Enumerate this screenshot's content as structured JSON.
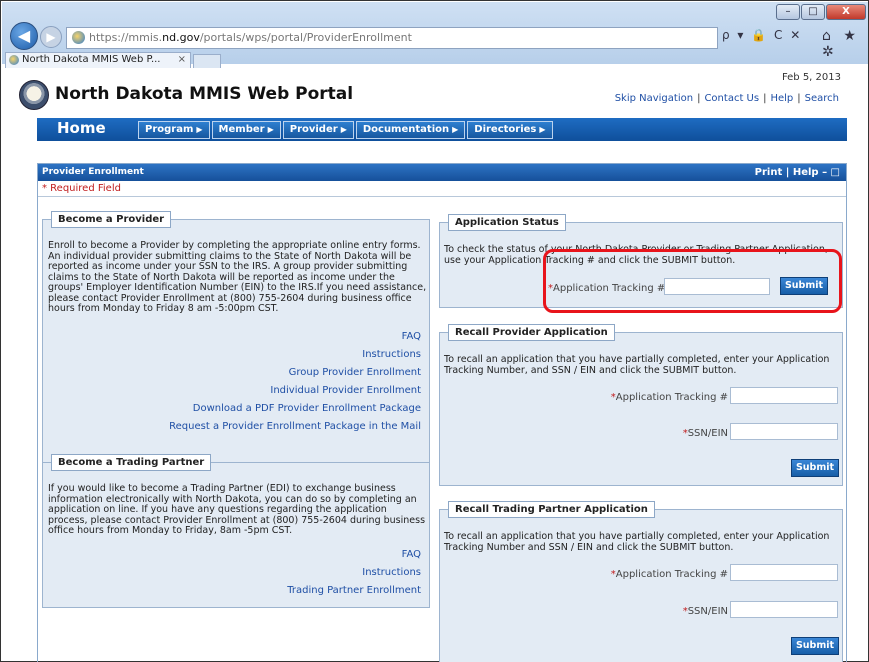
{
  "browser": {
    "url_prefix": "https://mmis.",
    "url_domain": "nd.gov",
    "url_path": "/portals/wps/portal/ProviderEnrollment",
    "tab_title": "North Dakota MMIS Web P...",
    "tab_close": "×",
    "addr_tools": "ρ ▾ 🔒 C ✕",
    "home_star": "⌂ ★ ✲",
    "win_min": "–",
    "win_max": "□",
    "win_close": "X",
    "back": "◀",
    "forward": "▶"
  },
  "header": {
    "date": "Feb 5, 2013",
    "title": "North Dakota MMIS Web Portal",
    "links": [
      "Skip Navigation",
      "Contact Us",
      "Help",
      "Search"
    ],
    "sep": "|"
  },
  "nav": {
    "home": "Home",
    "items": [
      "Program",
      "Member",
      "Provider",
      "Documentation",
      "Directories"
    ],
    "arrow": "▶"
  },
  "panel": {
    "title": "Provider Enrollment",
    "tools": "Print | Help  –  □",
    "required": "* Required Field"
  },
  "become_provider": {
    "title": "Become a Provider",
    "text": "Enroll to become a Provider by completing the appropriate online entry forms. An individual provider submitting claims to the State of North Dakota will be reported as income under your SSN to the IRS. A group provider submitting claims to the State of North Dakota will be reported as income under the groups' Employer Identification Number (EIN) to the IRS.If you need assistance, please contact Provider Enrollment at (800) 755-2604 during business office hours from Monday to Friday 8 am -5:00pm CST.",
    "links": [
      "FAQ",
      "Instructions",
      "Group Provider Enrollment",
      "Individual Provider Enrollment",
      "Download a PDF Provider Enrollment Package",
      "Request a Provider Enrollment Package in the Mail"
    ]
  },
  "become_partner": {
    "title": "Become a Trading Partner",
    "text": "If you would like to become a Trading Partner (EDI) to exchange business information electronically with North Dakota, you can do so by completing an application on line. If you have any questions regarding the application process, please contact Provider Enrollment at (800) 755-2604 during business office hours from Monday to Friday, 8am -5pm CST.",
    "links": [
      "FAQ",
      "Instructions",
      "Trading Partner Enrollment"
    ]
  },
  "app_status": {
    "title": "Application Status",
    "text": "To check the status of your North Dakota Provider or Trading Partner Application, use your Application Tracking # and click the SUBMIT button.",
    "label": "Application Tracking #",
    "star": "*",
    "submit": "Submit"
  },
  "recall_provider": {
    "title": "Recall Provider Application",
    "text": "To recall an application that you have partially completed, enter your Application Tracking Number, and SSN / EIN and click the SUBMIT button.",
    "label_tracking": "Application Tracking #",
    "label_ssn": "SSN/EIN",
    "star": "*",
    "submit": "Submit"
  },
  "recall_partner": {
    "title": "Recall Trading Partner Application",
    "text": "To recall an application that you have partially completed, enter your Application Tracking Number and SSN / EIN and click the SUBMIT button.",
    "label_tracking": "Application Tracking #",
    "label_ssn": "SSN/EIN",
    "star": "*",
    "submit": "Submit"
  },
  "colors": {
    "nav_blue": "#0f4f9b",
    "link_blue": "#1f4fa5",
    "highlight_red": "#e8141b",
    "box_bg": "#e3ebf4"
  }
}
